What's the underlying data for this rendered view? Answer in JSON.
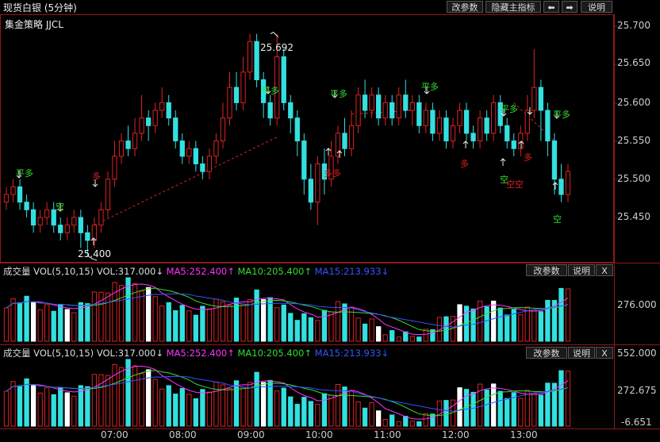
{
  "window": {
    "title": "现货白银 (5分钟)",
    "buttons": [
      "改参数",
      "隐藏主指标",
      "⬅",
      "➡",
      "说明"
    ]
  },
  "strategy_label": "集金策略 JJCL",
  "price_axis": [
    "25.700",
    "25.650",
    "25.600",
    "25.550",
    "25.500",
    "25.450"
  ],
  "annotations": {
    "high_marker": "25.692",
    "low_marker": "25.400",
    "signals": [
      {
        "text": "平多",
        "color": "#33dd33"
      },
      {
        "text": "空",
        "color": "#33dd33"
      },
      {
        "text": "多",
        "color": "#dd2222"
      },
      {
        "text": "平多",
        "color": "#33dd33"
      },
      {
        "text": "平多",
        "color": "#33dd33"
      },
      {
        "text": "多多",
        "color": "#dd2222"
      },
      {
        "text": "平多",
        "color": "#33dd33"
      },
      {
        "text": "多",
        "color": "#dd2222"
      },
      {
        "text": "平多",
        "color": "#33dd33"
      },
      {
        "text": "多",
        "color": "#dd2222"
      },
      {
        "text": "空",
        "color": "#33dd33"
      },
      {
        "text": "空空",
        "color": "#dd2222"
      },
      {
        "text": "平多",
        "color": "#33dd33"
      },
      {
        "text": "空",
        "color": "#33dd33"
      }
    ]
  },
  "volume_panels": [
    {
      "label": "成交量",
      "formula": "VOL(5,10,15)",
      "vol": "VOL:317.000↓",
      "ma5": "MA5:252.400↑",
      "ma10": "MA10:205.400↑",
      "ma15": "MA15:213.933↓",
      "buttons": [
        "改参数",
        "说明",
        "X"
      ],
      "axis": [
        "276.000"
      ]
    },
    {
      "label": "成交量",
      "formula": "VOL(5,10,15)",
      "vol": "VOL:317.000↓",
      "ma5": "MA5:252.400↑",
      "ma10": "MA10:205.400↑",
      "ma15": "MA15:213.933↓",
      "buttons": [
        "改参数",
        "说明",
        "X"
      ],
      "axis": [
        "552.000",
        "272.675",
        "-6.651"
      ]
    }
  ],
  "time_axis": [
    "07:00",
    "08:00",
    "09:00",
    "10:00",
    "11:00",
    "12:00",
    "13:00"
  ],
  "colors": {
    "up": "#dd2222",
    "down": "#33e0e0",
    "ma5": "#ff33ff",
    "ma10": "#33dd33",
    "ma15": "#3355ff",
    "signal_green": "#33dd33",
    "signal_red": "#dd2222"
  },
  "chart_data": {
    "type": "candlestick",
    "instrument": "现货白银 (5分钟)",
    "ylim": [
      25.43,
      25.71
    ],
    "x_ticks": [
      "07:00",
      "08:00",
      "09:00",
      "10:00",
      "11:00",
      "12:00",
      "13:00"
    ],
    "candles": [
      [
        25.47,
        25.48,
        25.46,
        25.49
      ],
      [
        25.48,
        25.49,
        25.47,
        25.5
      ],
      [
        25.49,
        25.47,
        25.46,
        25.5
      ],
      [
        25.47,
        25.46,
        25.45,
        25.48
      ],
      [
        25.46,
        25.44,
        25.43,
        25.47
      ],
      [
        25.44,
        25.45,
        25.43,
        25.46
      ],
      [
        25.45,
        25.46,
        25.44,
        25.47
      ],
      [
        25.46,
        25.44,
        25.43,
        25.47
      ],
      [
        25.44,
        25.43,
        25.42,
        25.45
      ],
      [
        25.43,
        25.44,
        25.42,
        25.45
      ],
      [
        25.44,
        25.45,
        25.43,
        25.46
      ],
      [
        25.45,
        25.43,
        25.41,
        25.46
      ],
      [
        25.43,
        25.42,
        25.4,
        25.44
      ],
      [
        25.42,
        25.44,
        25.41,
        25.45
      ],
      [
        25.44,
        25.46,
        25.43,
        25.47
      ],
      [
        25.46,
        25.5,
        25.45,
        25.51
      ],
      [
        25.5,
        25.53,
        25.49,
        25.55
      ],
      [
        25.53,
        25.55,
        25.52,
        25.56
      ],
      [
        25.55,
        25.54,
        25.53,
        25.57
      ],
      [
        25.54,
        25.56,
        25.53,
        25.58
      ],
      [
        25.56,
        25.58,
        25.55,
        25.61
      ],
      [
        25.58,
        25.57,
        25.55,
        25.59
      ],
      [
        25.57,
        25.59,
        25.56,
        25.6
      ],
      [
        25.59,
        25.6,
        25.58,
        25.62
      ],
      [
        25.6,
        25.58,
        25.57,
        25.61
      ],
      [
        25.58,
        25.55,
        25.54,
        25.59
      ],
      [
        25.55,
        25.53,
        25.52,
        25.56
      ],
      [
        25.53,
        25.54,
        25.52,
        25.55
      ],
      [
        25.54,
        25.52,
        25.51,
        25.55
      ],
      [
        25.52,
        25.51,
        25.5,
        25.53
      ],
      [
        25.51,
        25.53,
        25.5,
        25.54
      ],
      [
        25.53,
        25.55,
        25.52,
        25.56
      ],
      [
        25.55,
        25.58,
        25.54,
        25.6
      ],
      [
        25.58,
        25.62,
        25.57,
        25.64
      ],
      [
        25.62,
        25.6,
        25.59,
        25.64
      ],
      [
        25.6,
        25.64,
        25.59,
        25.66
      ],
      [
        25.64,
        25.68,
        25.63,
        25.69
      ],
      [
        25.68,
        25.63,
        25.62,
        25.69
      ],
      [
        25.63,
        25.6,
        25.58,
        25.64
      ],
      [
        25.6,
        25.58,
        25.57,
        25.61
      ],
      [
        25.58,
        25.66,
        25.57,
        25.69
      ],
      [
        25.66,
        25.6,
        25.59,
        25.67
      ],
      [
        25.6,
        25.58,
        25.56,
        25.61
      ],
      [
        25.58,
        25.55,
        25.53,
        25.59
      ],
      [
        25.55,
        25.5,
        25.48,
        25.56
      ],
      [
        25.5,
        25.47,
        25.46,
        25.52
      ],
      [
        25.47,
        25.52,
        25.44,
        25.53
      ],
      [
        25.52,
        25.5,
        25.48,
        25.54
      ],
      [
        25.5,
        25.53,
        25.49,
        25.55
      ],
      [
        25.53,
        25.56,
        25.52,
        25.57
      ],
      [
        25.56,
        25.54,
        25.53,
        25.58
      ],
      [
        25.54,
        25.57,
        25.53,
        25.59
      ],
      [
        25.57,
        25.61,
        25.56,
        25.62
      ],
      [
        25.61,
        25.59,
        25.58,
        25.63
      ],
      [
        25.59,
        25.61,
        25.58,
        25.62
      ],
      [
        25.61,
        25.58,
        25.57,
        25.62
      ],
      [
        25.58,
        25.6,
        25.57,
        25.61
      ],
      [
        25.6,
        25.58,
        25.57,
        25.61
      ],
      [
        25.58,
        25.61,
        25.57,
        25.62
      ],
      [
        25.61,
        25.59,
        25.58,
        25.63
      ],
      [
        25.59,
        25.6,
        25.57,
        25.61
      ],
      [
        25.6,
        25.57,
        25.56,
        25.61
      ],
      [
        25.57,
        25.59,
        25.56,
        25.6
      ],
      [
        25.59,
        25.56,
        25.55,
        25.6
      ],
      [
        25.56,
        25.58,
        25.55,
        25.59
      ],
      [
        25.58,
        25.55,
        25.54,
        25.59
      ],
      [
        25.55,
        25.57,
        25.54,
        25.58
      ],
      [
        25.57,
        25.59,
        25.56,
        25.6
      ],
      [
        25.59,
        25.56,
        25.55,
        25.6
      ],
      [
        25.56,
        25.55,
        25.54,
        25.57
      ],
      [
        25.55,
        25.58,
        25.54,
        25.59
      ],
      [
        25.58,
        25.56,
        25.55,
        25.59
      ],
      [
        25.56,
        25.6,
        25.55,
        25.61
      ],
      [
        25.6,
        25.57,
        25.56,
        25.61
      ],
      [
        25.57,
        25.55,
        25.54,
        25.58
      ],
      [
        25.55,
        25.54,
        25.53,
        25.56
      ],
      [
        25.54,
        25.56,
        25.53,
        25.57
      ],
      [
        25.56,
        25.59,
        25.55,
        25.61
      ],
      [
        25.59,
        25.62,
        25.58,
        25.67
      ],
      [
        25.62,
        25.59,
        25.55,
        25.63
      ],
      [
        25.59,
        25.55,
        25.53,
        25.6
      ],
      [
        25.55,
        25.5,
        25.48,
        25.56
      ],
      [
        25.5,
        25.48,
        25.47,
        25.52
      ],
      [
        25.48,
        25.51,
        25.47,
        25.52
      ]
    ],
    "volume_ma": [
      "MA5",
      "MA10",
      "MA15"
    ]
  }
}
